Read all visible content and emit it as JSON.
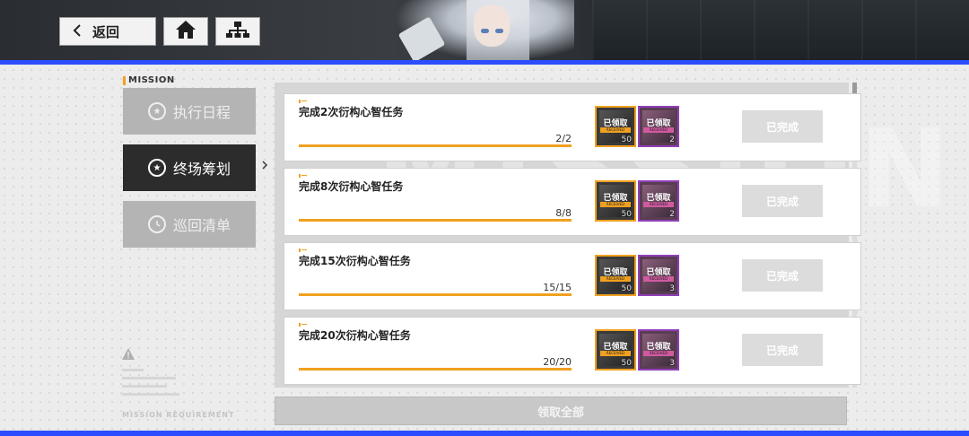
{
  "header": {
    "back_label": "返回",
    "back_icon": "chevron-left-icon",
    "home_icon": "home-icon",
    "tree_icon": "hierarchy-icon"
  },
  "colors": {
    "accent_blue": "#2b4cff",
    "accent_orange": "#f0a020",
    "reward_purple": "#8e3fb6"
  },
  "sidebar": {
    "section_label": "MISSION",
    "items": [
      {
        "label": "执行日程",
        "icon": "star-icon",
        "state": "inactive"
      },
      {
        "label": "终场筹划",
        "icon": "star-icon",
        "state": "active"
      },
      {
        "label": "巡回清单",
        "icon": "clock-icon",
        "state": "inactive"
      }
    ],
    "requirement_caption": "MISSION REQUIREMENT",
    "warning_icon": "warning-icon"
  },
  "watermark_text": "MISSION",
  "missions": [
    {
      "title": "完成2次衍构心智任务",
      "progress": "2/2",
      "ratio": 1.0,
      "rewards": [
        {
          "status": "已领取",
          "sub": "RECEIVED",
          "qty": "50"
        },
        {
          "status": "已领取",
          "sub": "RECEIVED",
          "qty": "2"
        }
      ],
      "button": "已完成"
    },
    {
      "title": "完成8次衍构心智任务",
      "progress": "8/8",
      "ratio": 1.0,
      "rewards": [
        {
          "status": "已领取",
          "sub": "RECEIVED",
          "qty": "50"
        },
        {
          "status": "已领取",
          "sub": "RECEIVED",
          "qty": "2"
        }
      ],
      "button": "已完成"
    },
    {
      "title": "完成15次衍构心智任务",
      "progress": "15/15",
      "ratio": 1.0,
      "rewards": [
        {
          "status": "已领取",
          "sub": "RECEIVED",
          "qty": "50"
        },
        {
          "status": "已领取",
          "sub": "RECEIVED",
          "qty": "3"
        }
      ],
      "button": "已完成"
    },
    {
      "title": "完成20次衍构心智任务",
      "progress": "20/20",
      "ratio": 1.0,
      "rewards": [
        {
          "status": "已领取",
          "sub": "RECEIVED",
          "qty": "50"
        },
        {
          "status": "已领取",
          "sub": "RECEIVED",
          "qty": "3"
        }
      ],
      "button": "已完成"
    }
  ],
  "footer": {
    "claim_all_label": "领取全部"
  }
}
